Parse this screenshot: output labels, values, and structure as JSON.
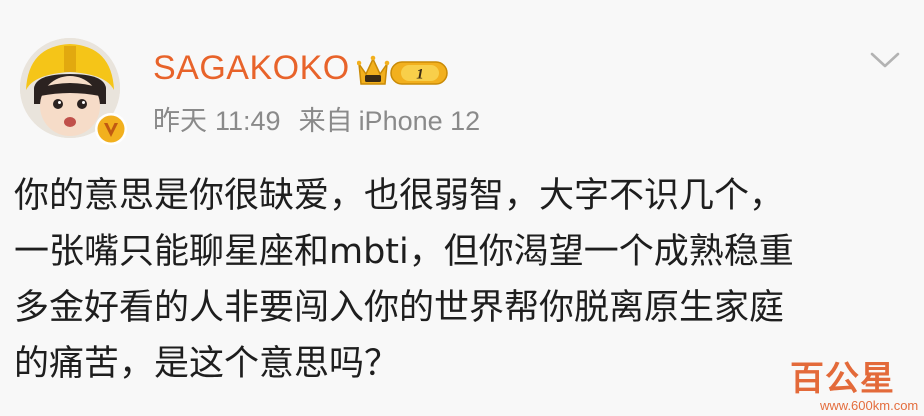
{
  "post": {
    "username": "SAGAKOKO",
    "level_badge": "1",
    "timestamp_day": "昨天",
    "timestamp_time": "11:49",
    "source_label": "来自",
    "source_device": "iPhone 12",
    "body_lines": [
      "你的意思是你很缺爱，也很弱智，大字不识几个，",
      "一张嘴只能聊星座和mbti，但你渴望一个成熟稳重",
      "多金好看的人非要闯入你的世界帮你脱离原生家庭",
      "的痛苦，是这个意思吗？"
    ]
  },
  "icons": {
    "avatar": "avatar-image",
    "verified": "verified-v-icon",
    "crown": "crown-level-icon",
    "chevron": "chevron-down-icon"
  },
  "watermark": {
    "logo": "百公星",
    "url": "www.600km.com"
  },
  "colors": {
    "username": "#e8632a",
    "meta": "#8a8a8a",
    "body": "#1e1e1e",
    "background": "#f8f8f8",
    "badge_gold": "#f2b01e"
  }
}
